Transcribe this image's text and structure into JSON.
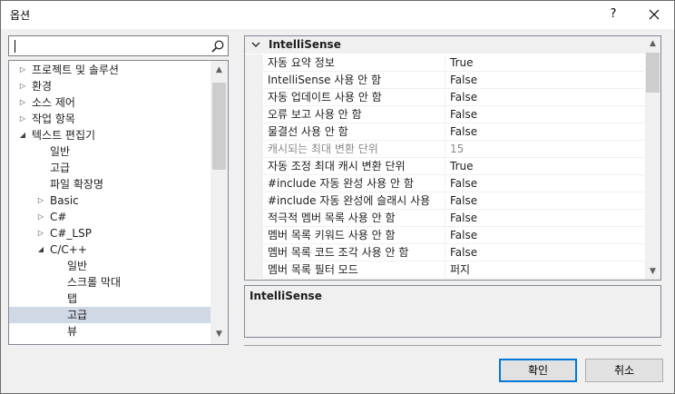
{
  "window": {
    "title": "옵션",
    "help_label": "?"
  },
  "search": {
    "value": ""
  },
  "tree": {
    "items": [
      {
        "label": "프로젝트 및 솔루션",
        "level": 0,
        "state": "collapsed"
      },
      {
        "label": "환경",
        "level": 0,
        "state": "collapsed"
      },
      {
        "label": "소스 제어",
        "level": 0,
        "state": "collapsed"
      },
      {
        "label": "작업 항목",
        "level": 0,
        "state": "collapsed"
      },
      {
        "label": "텍스트 편집기",
        "level": 0,
        "state": "expanded"
      },
      {
        "label": "일반",
        "level": 1,
        "state": "leaf"
      },
      {
        "label": "고급",
        "level": 1,
        "state": "leaf"
      },
      {
        "label": "파일 확장명",
        "level": 1,
        "state": "leaf"
      },
      {
        "label": "Basic",
        "level": 1,
        "state": "collapsed"
      },
      {
        "label": "C#",
        "level": 1,
        "state": "collapsed"
      },
      {
        "label": "C#_LSP",
        "level": 1,
        "state": "collapsed"
      },
      {
        "label": "C/C++",
        "level": 1,
        "state": "expanded"
      },
      {
        "label": "일반",
        "level": 2,
        "state": "leaf"
      },
      {
        "label": "스크롤 막대",
        "level": 2,
        "state": "leaf"
      },
      {
        "label": "탭",
        "level": 2,
        "state": "leaf"
      },
      {
        "label": "고급",
        "level": 2,
        "state": "leaf",
        "selected": true
      },
      {
        "label": "뷰",
        "level": 2,
        "state": "leaf"
      }
    ]
  },
  "grid": {
    "category": "IntelliSense",
    "properties": [
      {
        "name": "자동 요약 정보",
        "value": "True",
        "disabled": false
      },
      {
        "name": "IntelliSense 사용 안 함",
        "value": "False",
        "disabled": false
      },
      {
        "name": "자동 업데이트 사용 안 함",
        "value": "False",
        "disabled": false
      },
      {
        "name": "오류 보고 사용 안 함",
        "value": "False",
        "disabled": false
      },
      {
        "name": "물결선 사용 안 함",
        "value": "False",
        "disabled": false
      },
      {
        "name": "캐시되는 최대 변환 단위",
        "value": "15",
        "disabled": true
      },
      {
        "name": "자동 조정 최대 캐시 변환 단위",
        "value": "True",
        "disabled": false
      },
      {
        "name": "#include 자동 완성 사용 안 함",
        "value": "False",
        "disabled": false
      },
      {
        "name": "#include 자동 완성에 슬래시 사용",
        "value": "False",
        "disabled": false
      },
      {
        "name": "적극적 멤버 목록 사용 안 함",
        "value": "False",
        "disabled": false
      },
      {
        "name": "멤버 목록 키워드 사용 안 함",
        "value": "False",
        "disabled": false
      },
      {
        "name": "멤버 목록 코드 조각 사용 안 함",
        "value": "False",
        "disabled": false
      },
      {
        "name": "멤버 목록 필터 모드",
        "value": "퍼지",
        "disabled": false
      }
    ]
  },
  "description": {
    "title": "IntelliSense"
  },
  "buttons": {
    "ok": "확인",
    "cancel": "취소"
  },
  "colors": {
    "accent": "#0078d7",
    "selection": "#d0d7e5"
  }
}
